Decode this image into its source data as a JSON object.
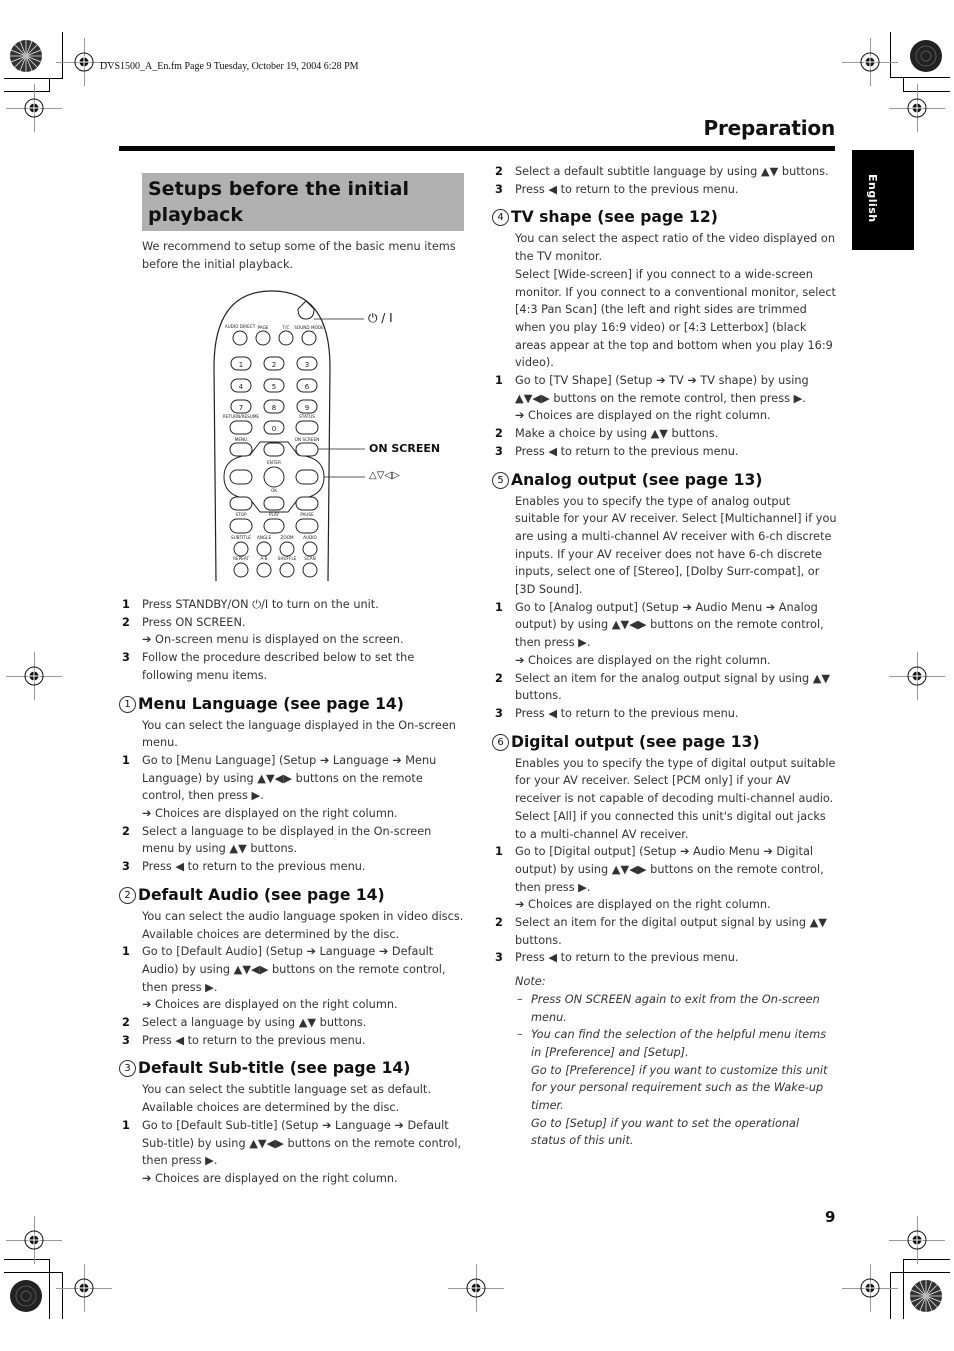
{
  "print_header": "DVS1500_A_En.fm  Page 9  Tuesday, October 19, 2004  6:28 PM",
  "section_header": "Preparation",
  "language_tab": "English",
  "page_number": "9",
  "setup": {
    "title": "Setups before the initial playback",
    "intro": "We recommend to setup some of the basic menu items before the initial playback."
  },
  "remote": {
    "callouts": {
      "power": "⏻ / I",
      "on_screen": "ON SCREEN",
      "arrows": "△▽◁▷"
    },
    "button_labels": {
      "audio_direct": "AUDIO DIRECT",
      "page": "PAGE",
      "tc": "T/C",
      "sound_mode": "SOUND MODE",
      "return_resume": "RETURN/RESUME",
      "status": "STATUS",
      "menu": "MENU",
      "on_screen": "ON SCREEN",
      "enter": "ENTER",
      "ok": "OK",
      "stop": "STOP",
      "play": "PLAY",
      "pause": "PAUSE",
      "subtitle": "SUBTITLE",
      "angle": "ANGLE",
      "zoom": "ZOOM",
      "audio": "AUDIO",
      "repeat": "REPEAT",
      "ab": "A-B",
      "shuffle": "SHUFFLE",
      "scan": "SCAN"
    },
    "digits": [
      "1",
      "2",
      "3",
      "4",
      "5",
      "6",
      "7",
      "8",
      "9",
      "0"
    ]
  },
  "initial_steps": [
    {
      "num": "1",
      "text": "Press STANDBY/ON ⏻/I to turn on the unit."
    },
    {
      "num": "2",
      "text": "Press ON SCREEN."
    },
    {
      "num": "",
      "text": "➔ On-screen menu is displayed on the screen."
    },
    {
      "num": "3",
      "text": "Follow the procedure described below to set the following menu items."
    }
  ],
  "sections": [
    {
      "marker": "1",
      "title": "Menu Language (see page 14)",
      "desc": "You can select the language displayed in the On-screen menu.",
      "steps": [
        {
          "num": "1",
          "text": "Go to [Menu Language] (Setup ➔ Language ➔ Menu Language) by using ▲▼◀▶ buttons on the remote control, then press ▶."
        },
        {
          "num": "",
          "text": "➔ Choices are displayed on the right column."
        },
        {
          "num": "2",
          "text": "Select a language to be displayed in the On-screen menu by using ▲▼  buttons."
        },
        {
          "num": "3",
          "text": "Press ◀ to return to the previous menu."
        }
      ]
    },
    {
      "marker": "2",
      "title": "Default Audio (see page 14)",
      "desc": "You can select the audio language spoken in video discs. Available choices are determined by the disc.",
      "steps": [
        {
          "num": "1",
          "text": "Go to [Default Audio] (Setup ➔ Language ➔ Default Audio) by using ▲▼◀▶ buttons on the remote control, then press ▶."
        },
        {
          "num": "",
          "text": "➔ Choices are displayed on the right column."
        },
        {
          "num": "2",
          "text": "Select a language by using ▲▼ buttons."
        },
        {
          "num": "3",
          "text": "Press ◀ to return to the previous menu."
        }
      ]
    },
    {
      "marker": "3",
      "title": "Default Sub-title (see page 14)",
      "desc": "You can select the subtitle language set as default. Available choices are determined by the disc.",
      "steps": [
        {
          "num": "1",
          "text": "Go to [Default Sub-title] (Setup ➔ Language ➔ Default Sub-title) by using ▲▼◀▶ buttons on the remote control, then press ▶."
        },
        {
          "num": "",
          "text": "➔ Choices are displayed on the right column."
        },
        {
          "num": "2",
          "text": "Select a default subtitle language by using ▲▼ buttons."
        },
        {
          "num": "3",
          "text": "Press ◀ to return to the previous menu."
        }
      ]
    },
    {
      "marker": "4",
      "title": "TV shape (see page 12)",
      "desc": "You can select the aspect ratio of the video displayed on the TV monitor.",
      "desc2": "Select [Wide-screen] if you connect to a wide-screen monitor. If you connect to a conventional monitor, select [4:3 Pan Scan] (the left and right sides are trimmed when you play 16:9 video) or [4:3 Letterbox] (black areas appear at the top and bottom when you play 16:9 video).",
      "steps": [
        {
          "num": "1",
          "text": "Go to [TV Shape] (Setup ➔ TV ➔ TV shape) by using ▲▼◀▶ buttons on the remote control, then press ▶."
        },
        {
          "num": "",
          "text": "➔ Choices are displayed on the right column."
        },
        {
          "num": "2",
          "text": "Make a choice by using ▲▼ buttons."
        },
        {
          "num": "3",
          "text": "Press ◀ to return to the previous menu."
        }
      ]
    },
    {
      "marker": "5",
      "title": "Analog output (see page 13)",
      "desc": "Enables you to specify the type of analog output suitable for your AV receiver. Select [Multichannel] if you are using a multi-channel AV receiver with 6-ch discrete inputs. If your AV receiver does not have 6-ch discrete inputs, select one of [Stereo], [Dolby Surr-compat], or [3D Sound].",
      "steps": [
        {
          "num": "1",
          "text": "Go to [Analog output] (Setup ➔ Audio Menu ➔ Analog output) by using ▲▼◀▶ buttons on the remote control, then press ▶."
        },
        {
          "num": "",
          "text": "➔ Choices are displayed on the right column."
        },
        {
          "num": "2",
          "text": "Select an item for the analog output signal by using ▲▼ buttons."
        },
        {
          "num": "3",
          "text": "Press ◀ to return to the previous menu."
        }
      ]
    },
    {
      "marker": "6",
      "title": "Digital output (see page 13)",
      "desc": "Enables you to specify the type of digital output suitable for your AV receiver. Select [PCM only] if your AV receiver is not capable of decoding multi-channel audio. Select [All] if you connected this unit's digital out jacks to a multi-channel AV receiver.",
      "steps": [
        {
          "num": "1",
          "text": "Go to [Digital output] (Setup ➔ Audio Menu ➔ Digital output) by using ▲▼◀▶ buttons on the remote control, then press ▶."
        },
        {
          "num": "",
          "text": "➔ Choices are displayed on the right column."
        },
        {
          "num": "2",
          "text": "Select an item for the digital output signal by using ▲▼ buttons."
        },
        {
          "num": "3",
          "text": "Press ◀ to return to the previous menu."
        }
      ]
    }
  ],
  "note": {
    "label": "Note:",
    "items": [
      "Press ON SCREEN again to exit from the On-screen menu.",
      "You can find the selection of the helpful menu items in [Preference] and [Setup]."
    ],
    "extra": [
      "Go to [Preference] if you want to customize this unit for your personal requirement such as the Wake-up timer.",
      "Go to [Setup] if you want to set the operational status of this unit."
    ]
  }
}
